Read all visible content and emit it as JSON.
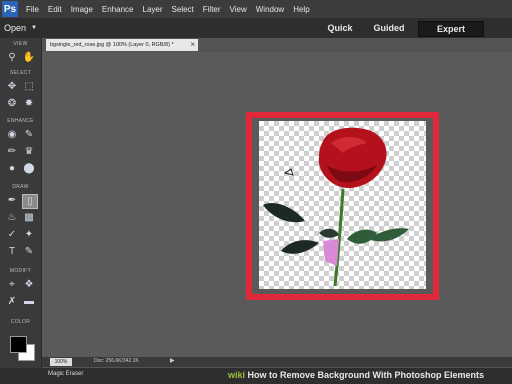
{
  "menubar": {
    "logo": "Ps",
    "items": [
      "File",
      "Edit",
      "Image",
      "Enhance",
      "Layer",
      "Select",
      "Filter",
      "View",
      "Window",
      "Help"
    ]
  },
  "modebar": {
    "open_label": "Open",
    "modes": [
      "Quick",
      "Guided",
      "Expert"
    ],
    "active_mode": "Expert"
  },
  "toolbox": {
    "sections": [
      "VIEW",
      "SELECT",
      "ENHANCE",
      "DRAW",
      "MODIFY",
      "COLOR"
    ]
  },
  "document": {
    "tab_title": "bgsingle_red_rose.jpg @ 100% (Layer 0, RGB/8) *",
    "close_glyph": "×"
  },
  "statusbar": {
    "zoom": "100%",
    "doc_info": "Doc: 256.6K/342.1K",
    "arrow": "▶"
  },
  "tool_options": {
    "tool_name": "Magic Eraser"
  },
  "watermark": {
    "wiki": "wiki",
    "text": "How to Remove Background With Photoshop Elements"
  },
  "colors": {
    "highlight_frame": "#e0283b",
    "rose": "#b3121c",
    "stem": "#3a7a2a"
  }
}
